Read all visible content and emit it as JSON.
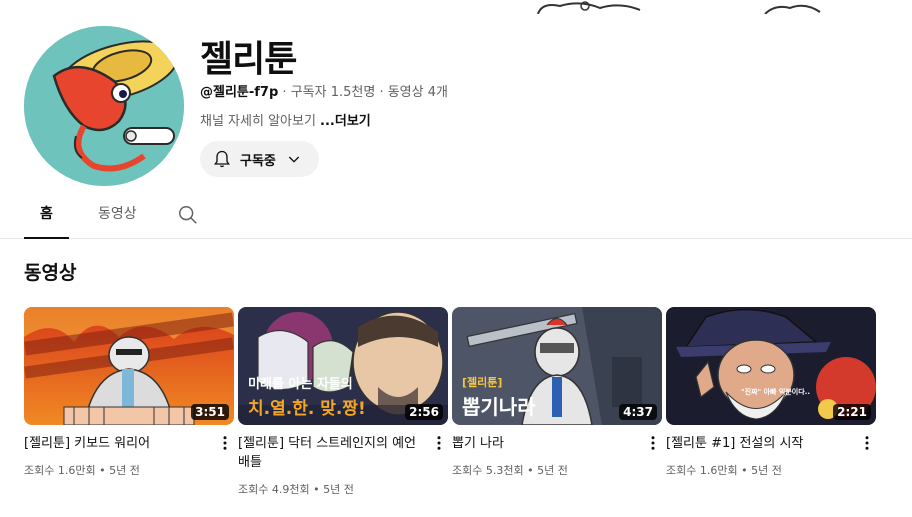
{
  "channel": {
    "name": "젤리툰",
    "handle": "@젤리툰-f7p",
    "sep": " · ",
    "subscribers": "구독자 1.5천명",
    "video_count": "동영상 4개",
    "description": "채널 자세히 알아보기 ",
    "more_label": "...더보기",
    "subscribe_label": "구독중"
  },
  "tabs": [
    {
      "label": "홈",
      "active": true
    },
    {
      "label": "동영상",
      "active": false
    }
  ],
  "section_title": "동영상",
  "videos": [
    {
      "title": "[젤리툰] 키보드 워리어",
      "duration": "3:51",
      "views": "조회수 1.6만회",
      "age": "5년 전",
      "overlay": ""
    },
    {
      "title": "[젤리툰] 닥터 스트레인지의 예언 배틀",
      "duration": "2:56",
      "views": "조회수 4.9천회",
      "age": "5년 전",
      "overlay_1": "미래를 아는 자들의",
      "overlay_2": "치.열.한. 맞.짱!"
    },
    {
      "title": "뽑기 나라",
      "duration": "4:37",
      "views": "조회수 5.3천회",
      "age": "5년 전",
      "overlay_tag": "[젤리툰]",
      "overlay_1": "뽑기나라"
    },
    {
      "title": "[젤리툰 #1] 전설의 시작",
      "duration": "2:21",
      "views": "조회수 1.6만회",
      "age": "5년 전",
      "overlay_1": "\"진짜\" 아빠 익분이다.."
    }
  ],
  "dot": " • ",
  "colors": {
    "accent": "#0f0f0f",
    "muted": "#606060",
    "chip": "#f2f2f2"
  }
}
